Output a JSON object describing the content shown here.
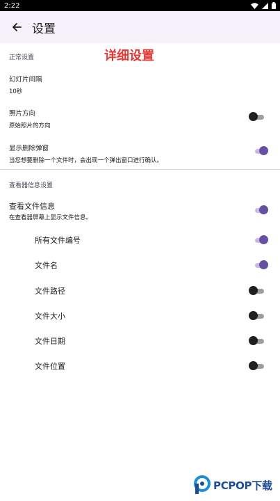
{
  "status_bar": {
    "time": "2:22"
  },
  "app_bar": {
    "title": "设置"
  },
  "overlay": {
    "title": "详细设置"
  },
  "general": {
    "header": "正常设置",
    "slideshow": {
      "title": "幻灯片间隔",
      "summary": "10秒"
    },
    "orientation": {
      "title": "照片方向",
      "summary": "原始照片的方向",
      "enabled": false
    },
    "delete_popup": {
      "title": "显示删除弹窗",
      "summary": "当您想要删除一个文件时，会出现一个弹出窗口进行确认。",
      "enabled": true
    }
  },
  "viewer": {
    "header": "查看器信息设置",
    "file_info": {
      "title": "查看文件信息",
      "summary": "在查看器屏幕上显示文件信息。",
      "enabled": true
    },
    "items": [
      {
        "label": "所有文件编号",
        "enabled": true
      },
      {
        "label": "文件名",
        "enabled": true
      },
      {
        "label": "文件路径",
        "enabled": false
      },
      {
        "label": "文件大小",
        "enabled": false
      },
      {
        "label": "文件日期",
        "enabled": false
      },
      {
        "label": "文件位置",
        "enabled": false
      }
    ]
  },
  "watermark": {
    "text": "PCPOP下载"
  },
  "colors": {
    "accent": "#6750a4",
    "accent_track": "#c9b8e8",
    "off_thumb": "#1f1f1f",
    "off_track": "#9e9e9e",
    "overlay_red": "#e53935",
    "app_bar_bg": "#f6f1fa"
  },
  "icons": {
    "back": "arrow-left-icon",
    "wifi": "wifi-icon",
    "signal": "signal-icon",
    "battery": "battery-icon",
    "watermark_logo": "pcpop-logo-icon"
  }
}
